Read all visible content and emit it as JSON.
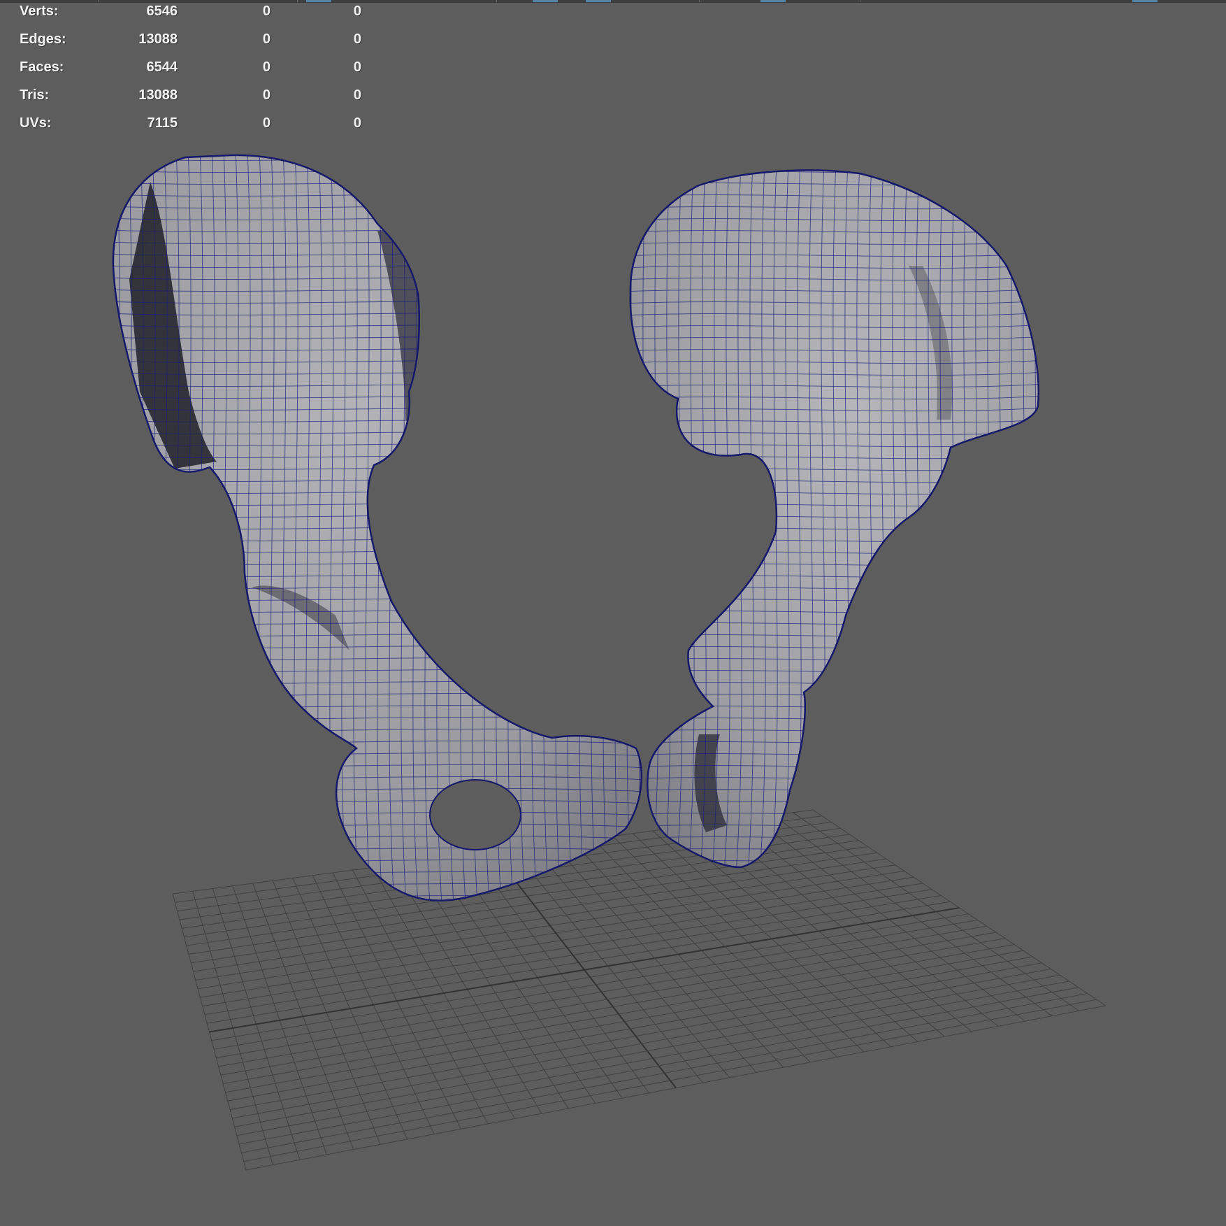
{
  "hud": {
    "rows": [
      {
        "label": "Verts:",
        "total": "6546",
        "selected": "0",
        "component": "0"
      },
      {
        "label": "Edges:",
        "total": "13088",
        "selected": "0",
        "component": "0"
      },
      {
        "label": "Faces:",
        "total": "6544",
        "selected": "0",
        "component": "0"
      },
      {
        "label": "Tris:",
        "total": "13088",
        "selected": "0",
        "component": "0"
      },
      {
        "label": "UVs:",
        "total": "7115",
        "selected": "0",
        "component": "0"
      }
    ]
  },
  "colors": {
    "viewport_background": "#5d5d5d",
    "hud_text": "#f2f2f2",
    "grid_line": "#3f3f3f",
    "grid_axis": "#2e2e2e",
    "mesh_fill": "#a4a4aa",
    "mesh_shadow": "#2a2a33",
    "wireframe": "#1c1f7a",
    "toolbar_highlight": "#5285a6"
  },
  "icons": {
    "left_bone": "left-hip-bone-mesh",
    "right_bone": "right-hip-bone-mesh",
    "grid": "ground-grid"
  }
}
